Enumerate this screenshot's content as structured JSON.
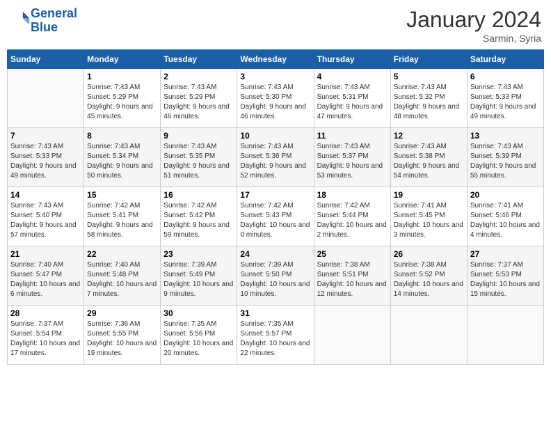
{
  "header": {
    "logo_line1": "General",
    "logo_line2": "Blue",
    "month_title": "January 2024",
    "subtitle": "Sarmin, Syria"
  },
  "weekdays": [
    "Sunday",
    "Monday",
    "Tuesday",
    "Wednesday",
    "Thursday",
    "Friday",
    "Saturday"
  ],
  "weeks": [
    [
      {
        "day": "",
        "sunrise": "",
        "sunset": "",
        "daylight": ""
      },
      {
        "day": "1",
        "sunrise": "7:43 AM",
        "sunset": "5:29 PM",
        "daylight": "9 hours and 45 minutes."
      },
      {
        "day": "2",
        "sunrise": "7:43 AM",
        "sunset": "5:29 PM",
        "daylight": "9 hours and 46 minutes."
      },
      {
        "day": "3",
        "sunrise": "7:43 AM",
        "sunset": "5:30 PM",
        "daylight": "9 hours and 46 minutes."
      },
      {
        "day": "4",
        "sunrise": "7:43 AM",
        "sunset": "5:31 PM",
        "daylight": "9 hours and 47 minutes."
      },
      {
        "day": "5",
        "sunrise": "7:43 AM",
        "sunset": "5:32 PM",
        "daylight": "9 hours and 48 minutes."
      },
      {
        "day": "6",
        "sunrise": "7:43 AM",
        "sunset": "5:33 PM",
        "daylight": "9 hours and 49 minutes."
      }
    ],
    [
      {
        "day": "7",
        "sunrise": "7:43 AM",
        "sunset": "5:33 PM",
        "daylight": "9 hours and 49 minutes."
      },
      {
        "day": "8",
        "sunrise": "7:43 AM",
        "sunset": "5:34 PM",
        "daylight": "9 hours and 50 minutes."
      },
      {
        "day": "9",
        "sunrise": "7:43 AM",
        "sunset": "5:35 PM",
        "daylight": "9 hours and 51 minutes."
      },
      {
        "day": "10",
        "sunrise": "7:43 AM",
        "sunset": "5:36 PM",
        "daylight": "9 hours and 52 minutes."
      },
      {
        "day": "11",
        "sunrise": "7:43 AM",
        "sunset": "5:37 PM",
        "daylight": "9 hours and 53 minutes."
      },
      {
        "day": "12",
        "sunrise": "7:43 AM",
        "sunset": "5:38 PM",
        "daylight": "9 hours and 54 minutes."
      },
      {
        "day": "13",
        "sunrise": "7:43 AM",
        "sunset": "5:39 PM",
        "daylight": "9 hours and 55 minutes."
      }
    ],
    [
      {
        "day": "14",
        "sunrise": "7:43 AM",
        "sunset": "5:40 PM",
        "daylight": "9 hours and 57 minutes."
      },
      {
        "day": "15",
        "sunrise": "7:42 AM",
        "sunset": "5:41 PM",
        "daylight": "9 hours and 58 minutes."
      },
      {
        "day": "16",
        "sunrise": "7:42 AM",
        "sunset": "5:42 PM",
        "daylight": "9 hours and 59 minutes."
      },
      {
        "day": "17",
        "sunrise": "7:42 AM",
        "sunset": "5:43 PM",
        "daylight": "10 hours and 0 minutes."
      },
      {
        "day": "18",
        "sunrise": "7:42 AM",
        "sunset": "5:44 PM",
        "daylight": "10 hours and 2 minutes."
      },
      {
        "day": "19",
        "sunrise": "7:41 AM",
        "sunset": "5:45 PM",
        "daylight": "10 hours and 3 minutes."
      },
      {
        "day": "20",
        "sunrise": "7:41 AM",
        "sunset": "5:46 PM",
        "daylight": "10 hours and 4 minutes."
      }
    ],
    [
      {
        "day": "21",
        "sunrise": "7:40 AM",
        "sunset": "5:47 PM",
        "daylight": "10 hours and 6 minutes."
      },
      {
        "day": "22",
        "sunrise": "7:40 AM",
        "sunset": "5:48 PM",
        "daylight": "10 hours and 7 minutes."
      },
      {
        "day": "23",
        "sunrise": "7:39 AM",
        "sunset": "5:49 PM",
        "daylight": "10 hours and 9 minutes."
      },
      {
        "day": "24",
        "sunrise": "7:39 AM",
        "sunset": "5:50 PM",
        "daylight": "10 hours and 10 minutes."
      },
      {
        "day": "25",
        "sunrise": "7:38 AM",
        "sunset": "5:51 PM",
        "daylight": "10 hours and 12 minutes."
      },
      {
        "day": "26",
        "sunrise": "7:38 AM",
        "sunset": "5:52 PM",
        "daylight": "10 hours and 14 minutes."
      },
      {
        "day": "27",
        "sunrise": "7:37 AM",
        "sunset": "5:53 PM",
        "daylight": "10 hours and 15 minutes."
      }
    ],
    [
      {
        "day": "28",
        "sunrise": "7:37 AM",
        "sunset": "5:54 PM",
        "daylight": "10 hours and 17 minutes."
      },
      {
        "day": "29",
        "sunrise": "7:36 AM",
        "sunset": "5:55 PM",
        "daylight": "10 hours and 19 minutes."
      },
      {
        "day": "30",
        "sunrise": "7:35 AM",
        "sunset": "5:56 PM",
        "daylight": "10 hours and 20 minutes."
      },
      {
        "day": "31",
        "sunrise": "7:35 AM",
        "sunset": "5:57 PM",
        "daylight": "10 hours and 22 minutes."
      },
      {
        "day": "",
        "sunrise": "",
        "sunset": "",
        "daylight": ""
      },
      {
        "day": "",
        "sunrise": "",
        "sunset": "",
        "daylight": ""
      },
      {
        "day": "",
        "sunrise": "",
        "sunset": "",
        "daylight": ""
      }
    ]
  ],
  "labels": {
    "sunrise_prefix": "Sunrise: ",
    "sunset_prefix": "Sunset: ",
    "daylight_prefix": "Daylight: "
  }
}
